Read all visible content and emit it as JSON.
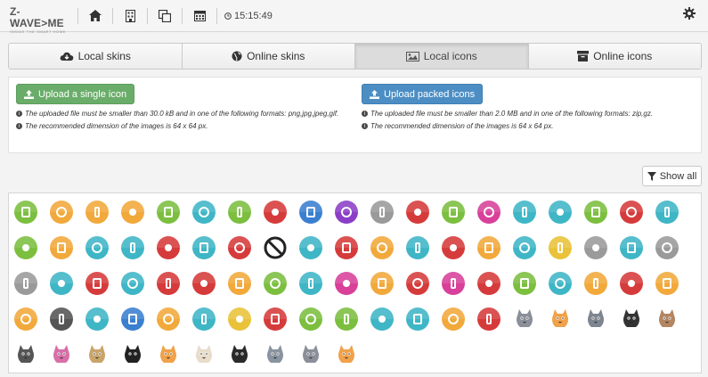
{
  "header": {
    "logo_main": "Z-WAVE>ME",
    "logo_sub": "INSIDE THE SMART HOME",
    "time": "15:15:49"
  },
  "tabs": [
    {
      "label": "Local skins",
      "icon": "cloud-download-icon",
      "active": false
    },
    {
      "label": "Online skins",
      "icon": "globe-icon",
      "active": false
    },
    {
      "label": "Local icons",
      "icon": "image-icon",
      "active": true
    },
    {
      "label": "Online icons",
      "icon": "archive-icon",
      "active": false
    }
  ],
  "upload_single": {
    "button_label": "Upload a single icon",
    "note1": "The uploaded file must be smaller than 30.0 kB and in one of the following formats: png,jpg,jpeg,gif.",
    "note2": "The recommended dimension of the images is 64 x 64 px."
  },
  "upload_packed": {
    "button_label": "Upload packed icons",
    "note1": "The uploaded file must be smaller than 2.0 MB and in one of the following formats: zip,gz.",
    "note2": "The recommended dimension of the images is 64 x 64 px."
  },
  "show_all_label": "Show all",
  "colors": {
    "green": "#7cbf3f",
    "orange": "#f2a93b",
    "teal": "#3fb6c6",
    "red": "#d63b3b",
    "gray": "#9a9a9a",
    "purple": "#8b3fc7",
    "magenta": "#d8409a",
    "blue": "#3a7fd0",
    "yellow": "#eac23a",
    "dark": "#555555"
  },
  "icon_rows": [
    [
      "green",
      "orange",
      "orange",
      "orange",
      "green",
      "teal",
      "green",
      "red",
      "blue",
      "purple",
      "gray",
      "red",
      "green",
      "magenta",
      "teal",
      "teal",
      "green",
      "red",
      "teal"
    ],
    [
      "green",
      "orange",
      "teal",
      "teal",
      "red",
      "teal",
      "red",
      "none",
      "teal",
      "red",
      "orange",
      "teal",
      "red",
      "orange",
      "teal",
      "yellow",
      "gray",
      "teal",
      "gray"
    ],
    [
      "gray",
      "teal",
      "red",
      "teal",
      "red",
      "red",
      "orange",
      "green",
      "teal",
      "magenta",
      "orange",
      "red",
      "magenta",
      "red",
      "green",
      "teal",
      "orange",
      "red",
      "orange"
    ],
    [
      "orange",
      "dark",
      "teal",
      "blue",
      "orange",
      "teal",
      "yellow",
      "red",
      "green",
      "green",
      "teal",
      "teal",
      "orange",
      "red",
      "cat",
      "cat",
      "cat",
      "cat",
      "cat"
    ],
    [
      "cat",
      "cat",
      "cat",
      "cat",
      "cat",
      "cat",
      "cat",
      "cat",
      "cat",
      "cat"
    ]
  ]
}
